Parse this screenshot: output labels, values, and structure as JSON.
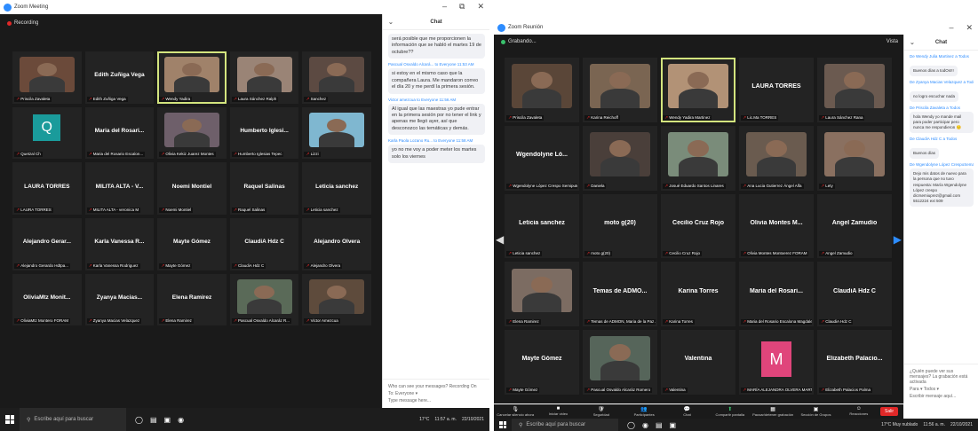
{
  "left": {
    "window_title": "Zoom Meeting",
    "recording_label": "Recording",
    "tiles": [
      {
        "name": "",
        "label": "Priscila Zavaleta",
        "photo": "#6b4a3a"
      },
      {
        "name": "Edith Zuñiga Vega",
        "label": "Edith Zuñiga Vega"
      },
      {
        "name": "",
        "label": "Wendy Yadira",
        "photo": "#a0826a",
        "active": true
      },
      {
        "name": "",
        "label": "Laura Sánchez Ralph",
        "photo": "#9a8476"
      },
      {
        "name": "",
        "label": "Sanchez",
        "photo": "#5c4a42"
      },
      {
        "name": "",
        "label": "Quetzal Ch",
        "avatar": "Q"
      },
      {
        "name": "Maria del Rosari...",
        "label": "Maria del Rosario Escalon..."
      },
      {
        "name": "",
        "label": "Olivia Kekiz Juarez Montes",
        "photo": "#6e5f6a"
      },
      {
        "name": "Humberto Iglesi...",
        "label": "Humberto Iglesias Tepec"
      },
      {
        "name": "",
        "label": "Lizzi",
        "photo": "#7fb7d0"
      },
      {
        "name": "LAURA TORRES",
        "label": "LAURA TORRES"
      },
      {
        "name": "MILITA ALTA - V...",
        "label": "MILITA ALTA - veronica M"
      },
      {
        "name": "Noemi Montiel",
        "label": "Noemi Montiel"
      },
      {
        "name": "Raquel Salinas",
        "label": "Raquel Salinas"
      },
      {
        "name": "Leticia sanchez",
        "label": "Leticia sanchez"
      },
      {
        "name": "Alejandro Gerar...",
        "label": "Alejandro Gerardo Hdtpa..."
      },
      {
        "name": "Karla Vanessa R...",
        "label": "Karla Vanessa Rodriguez"
      },
      {
        "name": "Mayte Gómez",
        "label": "Mayte Gómez"
      },
      {
        "name": "ClaudiA Hdz C",
        "label": "ClaudiA Hdz C"
      },
      {
        "name": "Alejandro Olvera",
        "label": "Alejandro Olvera"
      },
      {
        "name": "OliviaMtz Monit...",
        "label": "OliviaMtz Montero FORAM"
      },
      {
        "name": "Zyanya Macias...",
        "label": "Zyanya Macias Velazquez"
      },
      {
        "name": "Elena Ramirez",
        "label": "Elena Ramirez"
      },
      {
        "name": "",
        "label": "Pascual Osvaldo Alcaráz R...",
        "photo": "#5a6a58"
      },
      {
        "name": "",
        "label": "Victor Amezcua",
        "photo": "#5e4b3c"
      }
    ],
    "chat": {
      "title": "Chat",
      "messages": [
        {
          "from": "",
          "text": "será posible que me proporcionen la información que se habló el martes 19 de octubre??"
        },
        {
          "from": "Pascual Osvaldo Alcará... to Everyone 11:53 AM",
          "text": "si estoy en el mismo caso que la compañera Laura. Me mandaron correo el día 20 y me perdí la primera sesión."
        },
        {
          "from": "Victor amezcua to Everyone 11:56 AM",
          "text": "Al igual que las maestras yo pude entrar en la primera sesión por no tener el link y apenas me llegó ayer, así que desconozco las temáticas y demás."
        },
        {
          "from": "Karla Paola Lozano Ru... to Everyone 11:58 AM",
          "text": "yo no me voy a poder meter los martes solo los viernes"
        }
      ],
      "who_can_see": "Who can see your messages? Recording On",
      "to_label": "To: Everyone ▾",
      "placeholder": "Type message here..."
    },
    "taskbar": {
      "search": "Escribe aquí para buscar",
      "weather": "17°C",
      "time": "11:57 a. m.",
      "date": "22/10/2021"
    }
  },
  "right": {
    "window_title": "Zoom Reunión",
    "top_label": "Grabando...",
    "view_label": "Vista",
    "tiles": [
      {
        "name": "",
        "label": "Priscila Zavaleta",
        "photo": "#5a4638"
      },
      {
        "name": "",
        "label": "Karina Reichoff",
        "photo": "#7a6552"
      },
      {
        "name": "",
        "label": "Wendy Yadira Martinez",
        "photo": "#b29276",
        "active": true
      },
      {
        "name": "LAURA TORRES",
        "label": "Lic.Ma TORRES"
      },
      {
        "name": "",
        "label": "Laura Sánchez Rana",
        "photo": "#6b5a50"
      },
      {
        "name": "Wgendolyne Ló...",
        "label": "Wgendolyne López Crespo Semiputez"
      },
      {
        "name": "",
        "label": "Daniela",
        "photo": "#4a3f3a"
      },
      {
        "name": "",
        "label": "Josué Eduardo Santos Linares",
        "photo": "#7a8c7a"
      },
      {
        "name": "",
        "label": "Ana Lucia Gutierrez Ángel Alfa",
        "photo": "#6a5b4f"
      },
      {
        "name": "",
        "label": "Lety",
        "photo": "#8a7060"
      },
      {
        "name": "Leticia sanchez",
        "label": "Leticia sanchez"
      },
      {
        "name": "moto g(20)",
        "label": "moto g(20)"
      },
      {
        "name": "Cecilio Cruz Rojo",
        "label": "Cecilio Cruz Rojo"
      },
      {
        "name": "Olivia Montes M...",
        "label": "Olivia Montes Montoerez FORAM"
      },
      {
        "name": "Angel Zamudio",
        "label": "Angel Zamudio"
      },
      {
        "name": "",
        "label": "Elena Ramirez",
        "photo": "#7c6c62"
      },
      {
        "name": "Temas de ADMO...",
        "label": "Temas de ADMON, Maria de la Paz Jalpa CEC..."
      },
      {
        "name": "Karina Torres",
        "label": "Karina Torres"
      },
      {
        "name": "Maria del Rosari...",
        "label": "Maria del Rosario Escalona Magdaleno"
      },
      {
        "name": "ClaudiA Hdz C",
        "label": "ClaudiA Hdz C"
      },
      {
        "name": "Mayte Gómez",
        "label": "Mayte Gómez"
      },
      {
        "name": "",
        "label": "Pascual Osvaldo Alcaráz Romero",
        "photo": "#56655a"
      },
      {
        "name": "Valentina",
        "label": "Valentina"
      },
      {
        "name": "",
        "label": "MARÍA ALEJANDRA OLVERA MARTÍNEZ",
        "avatar": "M"
      },
      {
        "name": "Elizabeth Palacio...",
        "label": "Elizabeth Palacios Palma"
      }
    ],
    "chat": {
      "title": "Chat",
      "messages": [
        {
          "from": "De Wendy Julia Martinez a Todos",
          "text": "Buenos días a todOs!!!"
        },
        {
          "from": "De Zyanya Macias Velazquez a Todos",
          "text": "no logro escuchar nada"
        },
        {
          "from": "De Priscila Zavaleta a Todos",
          "text": "hola Wendy yo mande mail para poder participar pero nunca me respondieron 😔"
        },
        {
          "from": "De ClaudiA Hdz C a Todos",
          "text": "Buenos días"
        },
        {
          "from": "De Wgendolyne López CrespoSema... a Todos",
          "text": "Dejo mis datos de nuevo para la persona que no tuvo respuesta: María Wgendolyne López crespo dicrsemiuprez@gmail.com 5512224 ext 509"
        }
      ],
      "who_can_see": "¿Quién puede ver sus mensajes? La grabación está activada",
      "to_label": "Para ▾  Todos ▾",
      "placeholder": "Escribir mensaje aquí..."
    },
    "toolbar": [
      {
        "icon": "🎙",
        "label": "Cancelar silencio ahora"
      },
      {
        "icon": "■",
        "label": "Iniciar video"
      },
      {
        "icon": "🛡",
        "label": "Seguridad"
      },
      {
        "icon": "👥",
        "label": "Participantes"
      },
      {
        "icon": "💬",
        "label": "Chat"
      },
      {
        "icon": "⬆",
        "label": "Compartir pantalla",
        "share": true
      },
      {
        "icon": "▦",
        "label": "Pausar/detener grabación"
      },
      {
        "icon": "▣",
        "label": "Sección de Grupos"
      },
      {
        "icon": "☺",
        "label": "Reacciones"
      }
    ],
    "leave_label": "Salir",
    "taskbar": {
      "search": "Escribe aquí para buscar",
      "weather": "17°C Muy nublado",
      "time": "11:56 a. m.",
      "date": "22/10/2021"
    }
  }
}
